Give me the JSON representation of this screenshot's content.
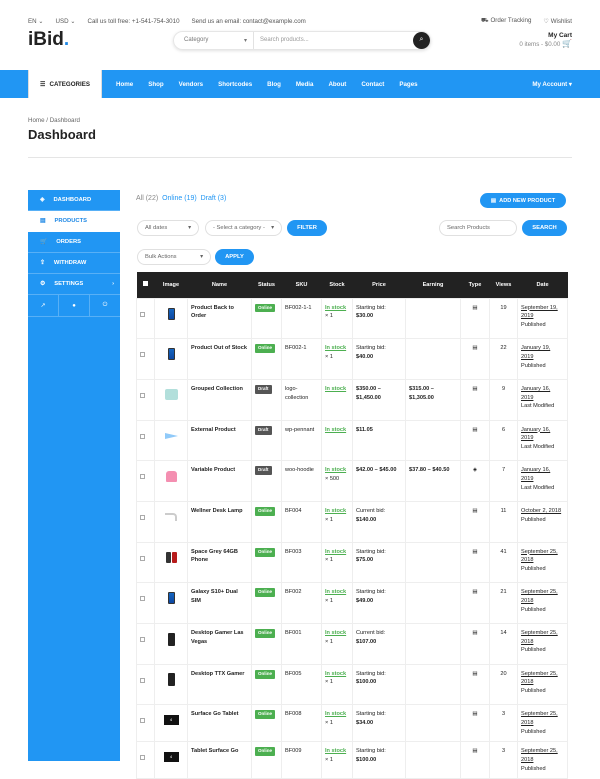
{
  "topbar": {
    "lang": "EN",
    "currency": "USD",
    "phone": "Call us toll free: +1-541-754-3010",
    "email": "Send us an email: contact@example.com",
    "tracking": "Order Tracking",
    "wishlist": "Wishlist"
  },
  "header": {
    "logo": "iBid",
    "search_category": "Category",
    "search_placeholder": "Search products...",
    "cart_title": "My Cart",
    "cart_sub": "0 items - $0.00"
  },
  "nav": {
    "categories": "CATEGORIES",
    "items": [
      "Home",
      "Shop",
      "Vendors",
      "Shortcodes",
      "Blog",
      "Media",
      "About",
      "Contact",
      "Pages"
    ],
    "account": "My Account"
  },
  "page": {
    "crumb_home": "Home",
    "crumb_sep": "/",
    "crumb_current": "Dashboard",
    "title": "Dashboard"
  },
  "sidebar": {
    "items": [
      "DASHBOARD",
      "PRODUCTS",
      "ORDERS",
      "WITHDRAW",
      "SETTINGS"
    ]
  },
  "filters": {
    "all": "All (22)",
    "online": "Online (19)",
    "draft": "Draft (3)",
    "add_new": "ADD NEW PRODUCT",
    "dates": "All dates",
    "category": "- Select a category -",
    "filter": "FILTER",
    "search_placeholder": "Search Products",
    "search": "SEARCH",
    "bulk": "Bulk Actions",
    "apply": "APPLY"
  },
  "table": {
    "headers": [
      "Image",
      "Name",
      "Status",
      "SKU",
      "Stock",
      "Price",
      "Earning",
      "Type",
      "Views",
      "Date"
    ],
    "rows": [
      {
        "name": "Product Back to Order",
        "status": "Online",
        "sku": "BF002-1-1",
        "stock": "In stock",
        "qty": "× 1",
        "price_label": "Starting bid:",
        "price": "$30.00",
        "earning": "",
        "views": "19",
        "date": "September 19, 2019",
        "state": "Published",
        "thumb": "phone-blue"
      },
      {
        "name": "Product Out of Stock",
        "status": "Online",
        "sku": "BF002-1",
        "stock": "In stock",
        "qty": "× 1",
        "price_label": "Starting bid:",
        "price": "$40.00",
        "earning": "",
        "views": "22",
        "date": "January 19, 2019",
        "state": "Published",
        "thumb": "phone-blue"
      },
      {
        "name": "Grouped Collection",
        "status": "Draft",
        "sku": "logo-collection",
        "stock": "In stock",
        "qty": "",
        "price_label": "",
        "price": "$350.00 – $1,450.00",
        "earning": "$315.00 – $1,305.00",
        "views": "9",
        "date": "January 16, 2019",
        "state": "Last Modified",
        "thumb": "shirt"
      },
      {
        "name": "External Product",
        "status": "Draft",
        "sku": "wp-pennant",
        "stock": "In stock",
        "qty": "",
        "price_label": "",
        "price": "$11.05",
        "earning": "",
        "views": "6",
        "date": "January 16, 2019",
        "state": "Last Modified",
        "thumb": "pennant"
      },
      {
        "name": "Variable Product",
        "status": "Draft",
        "sku": "woo-hoodie",
        "stock": "In stock",
        "qty": "× 500",
        "price_label": "",
        "price": "$42.00 – $45.00",
        "earning": "$37.80 – $40.50",
        "views": "7",
        "date": "January 16, 2019",
        "state": "Last Modified",
        "thumb": "hoodie"
      },
      {
        "name": "Wellner Desk Lamp",
        "status": "Online",
        "sku": "BF004",
        "stock": "In stock",
        "qty": "× 1",
        "price_label": "Current bid:",
        "price": "$140.00",
        "earning": "",
        "views": "11",
        "date": "October 2, 2018",
        "state": "Published",
        "thumb": "lamp"
      },
      {
        "name": "Space Grey 64GB Phone",
        "status": "Online",
        "sku": "BF003",
        "stock": "In stock",
        "qty": "× 1",
        "price_label": "Starting bid:",
        "price": "$75.00",
        "earning": "",
        "views": "41",
        "date": "September 25, 2018",
        "state": "Published",
        "thumb": "phone-dark"
      },
      {
        "name": "Galaxy S10+ Dual SIM",
        "status": "Online",
        "sku": "BF002",
        "stock": "In stock",
        "qty": "× 1",
        "price_label": "Starting bid:",
        "price": "$49.00",
        "earning": "",
        "views": "21",
        "date": "September 25, 2018",
        "state": "Published",
        "thumb": "phone-blue"
      },
      {
        "name": "Desktop Gamer Las Vegas",
        "status": "Online",
        "sku": "BF001",
        "stock": "In stock",
        "qty": "× 1",
        "price_label": "Current bid:",
        "price": "$107.00",
        "earning": "",
        "views": "14",
        "date": "September 25, 2018",
        "state": "Published",
        "thumb": "pc"
      },
      {
        "name": "Desktop TTX Gamer",
        "status": "Online",
        "sku": "BF005",
        "stock": "In stock",
        "qty": "× 1",
        "price_label": "Starting bid:",
        "price": "$100.00",
        "earning": "",
        "views": "20",
        "date": "September 25, 2018",
        "state": "Published",
        "thumb": "pc"
      },
      {
        "name": "Surface Go Tablet",
        "status": "Online",
        "sku": "BF008",
        "stock": "In stock",
        "qty": "× 1",
        "price_label": "Starting bid:",
        "price": "$34.00",
        "earning": "",
        "views": "3",
        "date": "September 25, 2018",
        "state": "Published",
        "thumb": "tablet"
      },
      {
        "name": "Tablet Surface Go",
        "status": "Online",
        "sku": "BF009",
        "stock": "In stock",
        "qty": "× 1",
        "price_label": "Starting bid:",
        "price": "$100.00",
        "earning": "",
        "views": "3",
        "date": "September 25, 2018",
        "state": "Published",
        "thumb": "tablet"
      }
    ]
  },
  "colors": {
    "accent": "#2196f3",
    "online": "#4caf50",
    "draft": "#555555"
  }
}
